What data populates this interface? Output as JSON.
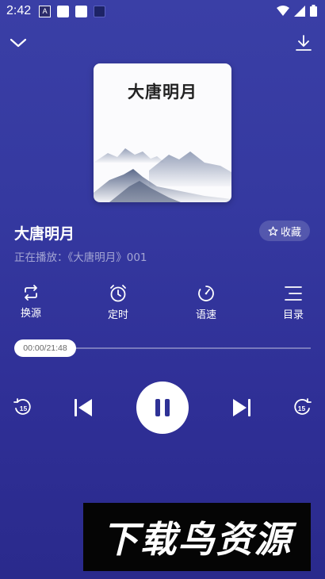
{
  "status_bar": {
    "time": "2:42",
    "icons": [
      "notification-a-icon",
      "white-square-icon",
      "white-square-icon",
      "dark-square-icon",
      "wifi-icon",
      "signal-icon",
      "battery-icon"
    ]
  },
  "header": {
    "left_icon": "chevron-down-icon",
    "right_icon": "download-icon"
  },
  "cover": {
    "title": "大唐明月"
  },
  "track": {
    "title": "大唐明月",
    "now_playing": "正在播放：《大唐明月》001",
    "favorite_label": "收藏",
    "favorite_icon": "star-outline-icon"
  },
  "tools": [
    {
      "label": "换源",
      "icon": "switch-source-icon"
    },
    {
      "label": "定时",
      "icon": "alarm-clock-icon"
    },
    {
      "label": "语速",
      "icon": "speed-gauge-icon"
    },
    {
      "label": "目录",
      "icon": "list-menu-icon"
    }
  ],
  "progress": {
    "time_text": "00:00/21:48",
    "fraction": 0
  },
  "controls": {
    "rewind_icon": "rewind-15-icon",
    "rewind_label": "15",
    "prev_icon": "skip-previous-icon",
    "play_icon": "pause-icon",
    "next_icon": "skip-next-icon",
    "forward_icon": "forward-15-icon",
    "forward_label": "15"
  },
  "watermark": {
    "text": "下载鸟资源"
  },
  "colors": {
    "background_top": "#3a3fa6",
    "background_bottom": "#2a2a8c",
    "accent": "#ffffff"
  }
}
